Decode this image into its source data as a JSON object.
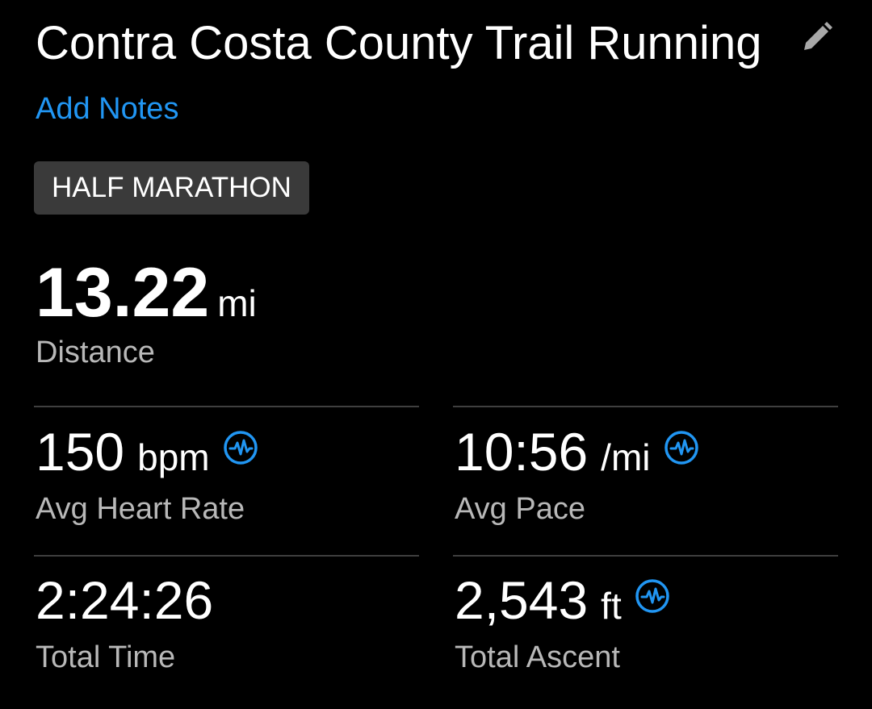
{
  "activity": {
    "title": "Contra Costa County Trail Running",
    "add_notes_label": "Add Notes",
    "tag": "HALF MARATHON"
  },
  "primary": {
    "value": "13.22",
    "unit": "mi",
    "label": "Distance"
  },
  "stats": {
    "heart_rate": {
      "value": "150",
      "unit": "bpm",
      "label": "Avg Heart Rate",
      "icon": "sensor-wave-icon"
    },
    "pace": {
      "value": "10:56",
      "unit": "/mi",
      "label": "Avg Pace",
      "icon": "sensor-wave-icon"
    },
    "time": {
      "value": "2:24:26",
      "unit": "",
      "label": "Total Time"
    },
    "ascent": {
      "value": "2,543",
      "unit": "ft",
      "label": "Total Ascent",
      "icon": "sensor-wave-icon"
    }
  },
  "colors": {
    "background": "#000000",
    "accent": "#2196f3",
    "tag_background": "#3a3a3a",
    "secondary_text": "#b8b8b8",
    "divider": "#3f3f3f"
  }
}
